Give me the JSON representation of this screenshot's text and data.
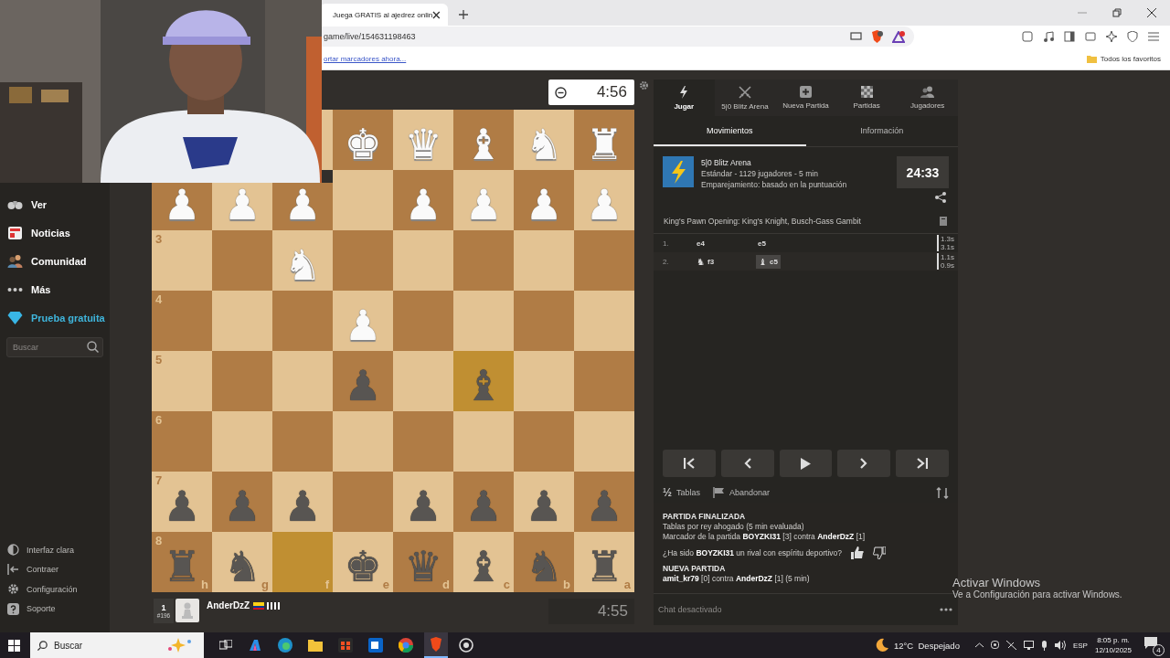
{
  "browser": {
    "tab_title": "Juega GRATIS al ajedrez onlin",
    "address": "game/live/154631198463",
    "bookmarks_prompt": "ortar marcadores ahora...",
    "favorites": "Todos los favoritos"
  },
  "sidebar": {
    "items": [
      {
        "label": "Ver",
        "kind": "nav"
      },
      {
        "label": "Noticias",
        "kind": "nav"
      },
      {
        "label": "Comunidad",
        "kind": "nav"
      },
      {
        "label": "Más",
        "kind": "nav"
      },
      {
        "label": "Prueba gratuita",
        "kind": "promo"
      }
    ],
    "search": {
      "placeholder": "Buscar"
    },
    "footer": [
      {
        "label": "Interfaz clara"
      },
      {
        "label": "Contraer"
      },
      {
        "label": "Configuración"
      },
      {
        "label": "Soporte"
      }
    ]
  },
  "opponent_clock": "4:56",
  "board": {
    "files": [
      "h",
      "g",
      "f",
      "e",
      "d",
      "c",
      "b",
      "a"
    ],
    "rows": [
      {
        "squares": [
          {
            "last_move": false
          },
          {
            "piece": "♚",
            "color": "#fafafa",
            "last_move": false
          },
          {
            "piece": "♛",
            "color": "#fafafa",
            "last_move": false
          },
          {
            "piece": "♝",
            "color": "#fafafa",
            "last_move": false
          },
          {
            "piece": "♞",
            "color": "#fafafa",
            "last_move": false
          },
          {
            "piece": "♜",
            "color": "#fafafa",
            "last_move": false
          }
        ]
      },
      {
        "squares": [
          {
            "piece": "♟",
            "color": "#fafafa",
            "last_move": false
          },
          {
            "piece": "♟",
            "color": "#fafafa",
            "last_move": false
          },
          {
            "piece": "♟",
            "color": "#fafafa",
            "last_move": false
          },
          {
            "last_move": false
          },
          {
            "piece": "♟",
            "color": "#fafafa",
            "last_move": false
          },
          {
            "piece": "♟",
            "color": "#fafafa",
            "last_move": false
          },
          {
            "piece": "♟",
            "color": "#fafafa",
            "last_move": false
          },
          {
            "piece": "♟",
            "color": "#fafafa",
            "last_move": false
          }
        ]
      },
      {
        "rank": "3",
        "squares": [
          {
            "last_move": false
          },
          {
            "last_move": false
          },
          {
            "piece": "♞",
            "color": "#fafafa",
            "last_move": false
          },
          {
            "last_move": false
          },
          {
            "last_move": false
          },
          {
            "last_move": false
          },
          {
            "last_move": false
          },
          {
            "last_move": false
          }
        ]
      },
      {
        "rank": "4",
        "squares": [
          {
            "last_move": false
          },
          {
            "last_move": false
          },
          {
            "last_move": false
          },
          {
            "piece": "♟",
            "color": "#fafafa",
            "last_move": false
          },
          {
            "last_move": false
          },
          {
            "last_move": false
          },
          {
            "last_move": false
          },
          {
            "last_move": false
          }
        ]
      },
      {
        "rank": "5",
        "squares": [
          {
            "last_move": false
          },
          {
            "last_move": false
          },
          {
            "last_move": false
          },
          {
            "piece": "♟",
            "color": "#585552",
            "last_move": false
          },
          {
            "last_move": false
          },
          {
            "piece": "♝",
            "color": "#585552",
            "last_move": true
          },
          {
            "last_move": false
          },
          {
            "last_move": false
          }
        ]
      },
      {
        "rank": "6",
        "squares": [
          {
            "last_move": false
          },
          {
            "last_move": false
          },
          {
            "last_move": false
          },
          {
            "last_move": false
          },
          {
            "last_move": false
          },
          {
            "last_move": false
          },
          {
            "last_move": false
          },
          {
            "last_move": false
          }
        ]
      },
      {
        "rank": "7",
        "squares": [
          {
            "piece": "♟",
            "color": "#585552",
            "last_move": false
          },
          {
            "piece": "♟",
            "color": "#585552",
            "last_move": false
          },
          {
            "piece": "♟",
            "color": "#585552",
            "last_move": false
          },
          {
            "last_move": false
          },
          {
            "piece": "♟",
            "color": "#585552",
            "last_move": false
          },
          {
            "piece": "♟",
            "color": "#585552",
            "last_move": false
          },
          {
            "piece": "♟",
            "color": "#585552",
            "last_move": false
          },
          {
            "piece": "♟",
            "color": "#585552",
            "last_move": false
          }
        ]
      },
      {
        "rank": "8",
        "squares": [
          {
            "piece": "♜",
            "color": "#585552",
            "last_move": false
          },
          {
            "piece": "♞",
            "color": "#585552",
            "last_move": false
          },
          {
            "last_move": true
          },
          {
            "piece": "♚",
            "color": "#585552",
            "last_move": false
          },
          {
            "piece": "♛",
            "color": "#585552",
            "last_move": false
          },
          {
            "piece": "♝",
            "color": "#585552",
            "last_move": false
          },
          {
            "piece": "♞",
            "color": "#585552",
            "last_move": false
          },
          {
            "piece": "♜",
            "color": "#585552",
            "last_move": false
          }
        ]
      }
    ]
  },
  "player": {
    "place": "1",
    "rank": "#196",
    "name": "AnderDzZ",
    "clock": "4:55"
  },
  "panel": {
    "tabs": [
      {
        "label": "Jugar",
        "selected": true
      },
      {
        "label": "5|0 Blitz Arena",
        "selected": false
      },
      {
        "label": "Nueva Partida",
        "selected": false
      },
      {
        "label": "Partidas",
        "selected": false
      },
      {
        "label": "Jugadores",
        "selected": false
      }
    ],
    "subtabs": [
      {
        "label": "Movimientos",
        "selected": true
      },
      {
        "label": "Información",
        "selected": false
      }
    ],
    "arena": {
      "title": "5|0 Blitz Arena",
      "details": "Estándar - 1129 jugadores - 5 min",
      "pairing": "Emparejamiento: basado en la puntuación",
      "timer": "24:33"
    },
    "opening": "King's Pawn Opening: King's Knight, Busch-Gass Gambit",
    "moves": [
      {
        "number": "1.",
        "white": {
          "san": "e4",
          "selected": false
        },
        "black": {
          "san": "e5",
          "selected": false
        },
        "times": [
          "1.3s",
          "3.1s"
        ]
      },
      {
        "number": "2.",
        "white": {
          "piece": "♞",
          "san": "f3",
          "selected": false
        },
        "black": {
          "piece": "♝",
          "san": "c5",
          "selected": true
        },
        "times": [
          "1.1s",
          "0.9s"
        ]
      }
    ],
    "actions": [
      {
        "kind": "draw",
        "icon": "½",
        "label": "Tablas"
      },
      {
        "kind": "resign",
        "label": "Abandonar"
      }
    ],
    "chat": [
      {
        "kind": "header",
        "text": "PARTIDA FINALIZADA"
      },
      {
        "kind": "text",
        "text": "Tablas por rey ahogado (5 min evaluada)"
      },
      {
        "kind": "text",
        "text": "Marcador de la partida **BOYZKI31** [3] contra **AnderDzZ** [1]"
      },
      {
        "kind": "question",
        "text": "¿Ha sido **BOYZKI31** un rival con espíritu deportivo?"
      },
      {
        "kind": "header",
        "text": "NUEVA PARTIDA"
      },
      {
        "kind": "text",
        "text": "**amit_kr79** [0] contra **AnderDzZ** [1] (5 min)"
      }
    ],
    "chat_status": "Chat desactivado"
  },
  "activation": {
    "title": "Activar Windows",
    "hint": "Ve a Configuración para activar Windows."
  },
  "taskbar": {
    "search": {
      "placeholder": "Buscar"
    },
    "weather": "12°C  Despejado",
    "language": "ESP",
    "time": "8:05 p. m.",
    "date": "12/10/2025",
    "notifications": "4"
  }
}
